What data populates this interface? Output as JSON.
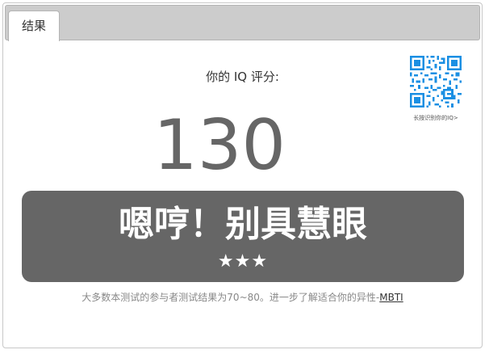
{
  "tabs": [
    {
      "label": "结果"
    }
  ],
  "score": {
    "label": "你的 IQ 评分:",
    "value": "130"
  },
  "qr": {
    "caption": "长按识别你的IQ>"
  },
  "result": {
    "title": "嗯哼！别具慧眼",
    "stars": "★★★",
    "star_count": 3
  },
  "footnote": {
    "text": "大多数本测试的参与者测试结果为70~80。进一步了解适合你的异性-",
    "link_label": "MBTI"
  },
  "colors": {
    "result_bg": "#666666",
    "score_text": "#666666",
    "qr_blue": "#1a8fe3"
  }
}
